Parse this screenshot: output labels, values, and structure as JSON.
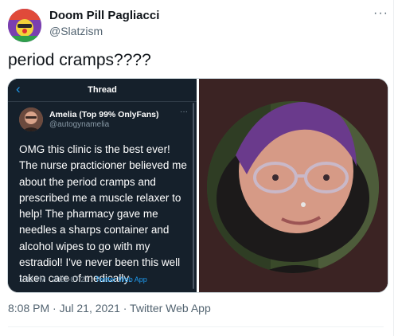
{
  "author": {
    "name": "Doom Pill Pagliacci",
    "handle": "@Slatzism",
    "avatar_icon": "clown-avatar-icon"
  },
  "tweet": {
    "text": "period cramps????",
    "more_label": "···"
  },
  "embedded": {
    "header_title": "Thread",
    "back_icon": "back-arrow-icon",
    "author_name": "Amelia (Top 99% OnlyFans)",
    "author_handle": "@autogynamelia",
    "more_label": "···",
    "body": "OMG this clinic is the best ever! The nurse practicioner believed me about the period cramps and prescribed me a muscle relaxer to help! The pharmacy gave me needles a sharps container and alcohol wipes to go with my estradiol! I've never been this well taken care of medically.",
    "time_date": "1:42 PM · 2021-07-21 · ",
    "source": "Twitter Web App"
  },
  "meta": {
    "timestamp": "8:08 PM · Jul 21, 2021 · Twitter Web App"
  },
  "colors": {
    "accent": "#1d9bf0",
    "dark_bg": "#15202b",
    "photo_bg": "#3b2323"
  }
}
